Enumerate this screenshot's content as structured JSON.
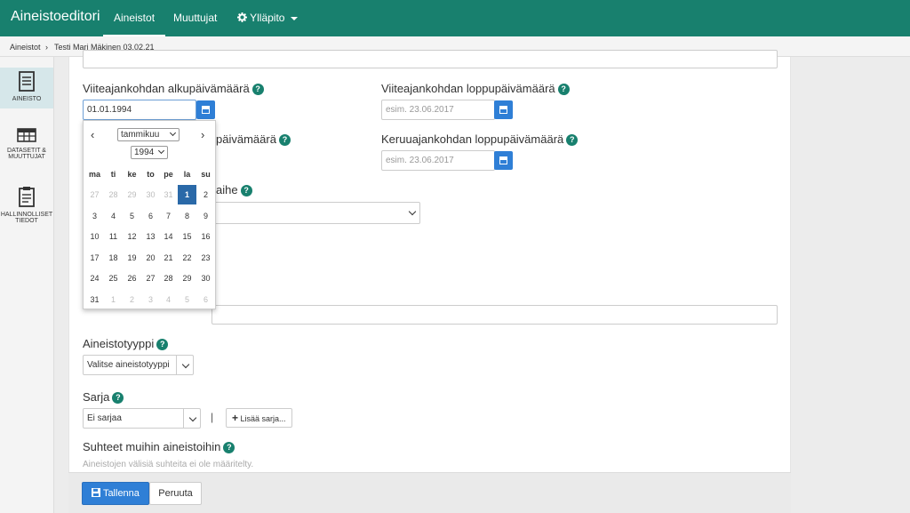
{
  "app": {
    "title": "Aineistoeditori"
  },
  "nav": {
    "items": [
      {
        "label": "Aineistot"
      },
      {
        "label": "Muuttujat"
      },
      {
        "label": "Ylläpito"
      }
    ]
  },
  "breadcrumb": {
    "root": "Aineistot",
    "separator": "›",
    "current": "Testi Mari Mäkinen 03.02.21"
  },
  "sidebar": {
    "items": [
      {
        "label": "AINEISTO",
        "icon": "document-icon"
      },
      {
        "label_line1": "DATASETIT &",
        "label_line2": "MUUTTUJAT",
        "icon": "table-icon"
      },
      {
        "label_line1": "HALLINNOLLISET",
        "label_line2": "TIEDOT",
        "icon": "clipboard-icon"
      }
    ]
  },
  "form": {
    "help_symbol": "?",
    "viite_start": {
      "label": "Viiteajankohdan alkupäivämäärä",
      "value": "01.01.1994"
    },
    "viite_end": {
      "label": "Viiteajankohdan loppupäivämäärä",
      "placeholder": "esim. 23.06.2017"
    },
    "keruu_start": {
      "label_visible": "päivämäärä"
    },
    "keruu_end": {
      "label": "Keruuajankohdan loppupäivämäärä",
      "placeholder": "esim. 23.06.2017"
    },
    "aihe": {
      "label_visible": "aihe"
    },
    "aineistotyyppi": {
      "label": "Aineistotyyppi",
      "value": "Valitse aineistotyyppi"
    },
    "sarja": {
      "label": "Sarja",
      "value": "Ei sarjaa",
      "separator": "|",
      "add_button": "Lisää sarja..."
    },
    "suhteet": {
      "label": "Suhteet muihin aineistoihin",
      "note": "Aineistojen välisiä suhteita ei ole määritelty."
    }
  },
  "datepicker": {
    "month": "tammikuu",
    "year": "1994",
    "prev": "‹",
    "next": "›",
    "weekdays": [
      "ma",
      "ti",
      "ke",
      "to",
      "pe",
      "la",
      "su"
    ],
    "weeks": [
      [
        {
          "d": "27",
          "m": true
        },
        {
          "d": "28",
          "m": true
        },
        {
          "d": "29",
          "m": true
        },
        {
          "d": "30",
          "m": true
        },
        {
          "d": "31",
          "m": true
        },
        {
          "d": "1",
          "s": true
        },
        {
          "d": "2"
        }
      ],
      [
        {
          "d": "3"
        },
        {
          "d": "4"
        },
        {
          "d": "5"
        },
        {
          "d": "6"
        },
        {
          "d": "7"
        },
        {
          "d": "8"
        },
        {
          "d": "9"
        }
      ],
      [
        {
          "d": "10"
        },
        {
          "d": "11"
        },
        {
          "d": "12"
        },
        {
          "d": "13"
        },
        {
          "d": "14"
        },
        {
          "d": "15"
        },
        {
          "d": "16"
        }
      ],
      [
        {
          "d": "17"
        },
        {
          "d": "18"
        },
        {
          "d": "19"
        },
        {
          "d": "20"
        },
        {
          "d": "21"
        },
        {
          "d": "22"
        },
        {
          "d": "23"
        }
      ],
      [
        {
          "d": "24"
        },
        {
          "d": "25"
        },
        {
          "d": "26"
        },
        {
          "d": "27"
        },
        {
          "d": "28"
        },
        {
          "d": "29"
        },
        {
          "d": "30"
        }
      ],
      [
        {
          "d": "31"
        },
        {
          "d": "1",
          "m": true
        },
        {
          "d": "2",
          "m": true
        },
        {
          "d": "3",
          "m": true
        },
        {
          "d": "4",
          "m": true
        },
        {
          "d": "5",
          "m": true
        },
        {
          "d": "6",
          "m": true
        }
      ]
    ]
  },
  "footer": {
    "save": "Tallenna",
    "cancel": "Peruuta"
  },
  "colors": {
    "brand": "#18806e",
    "primary": "#2f7fd6",
    "selected_day": "#2a69a8"
  }
}
